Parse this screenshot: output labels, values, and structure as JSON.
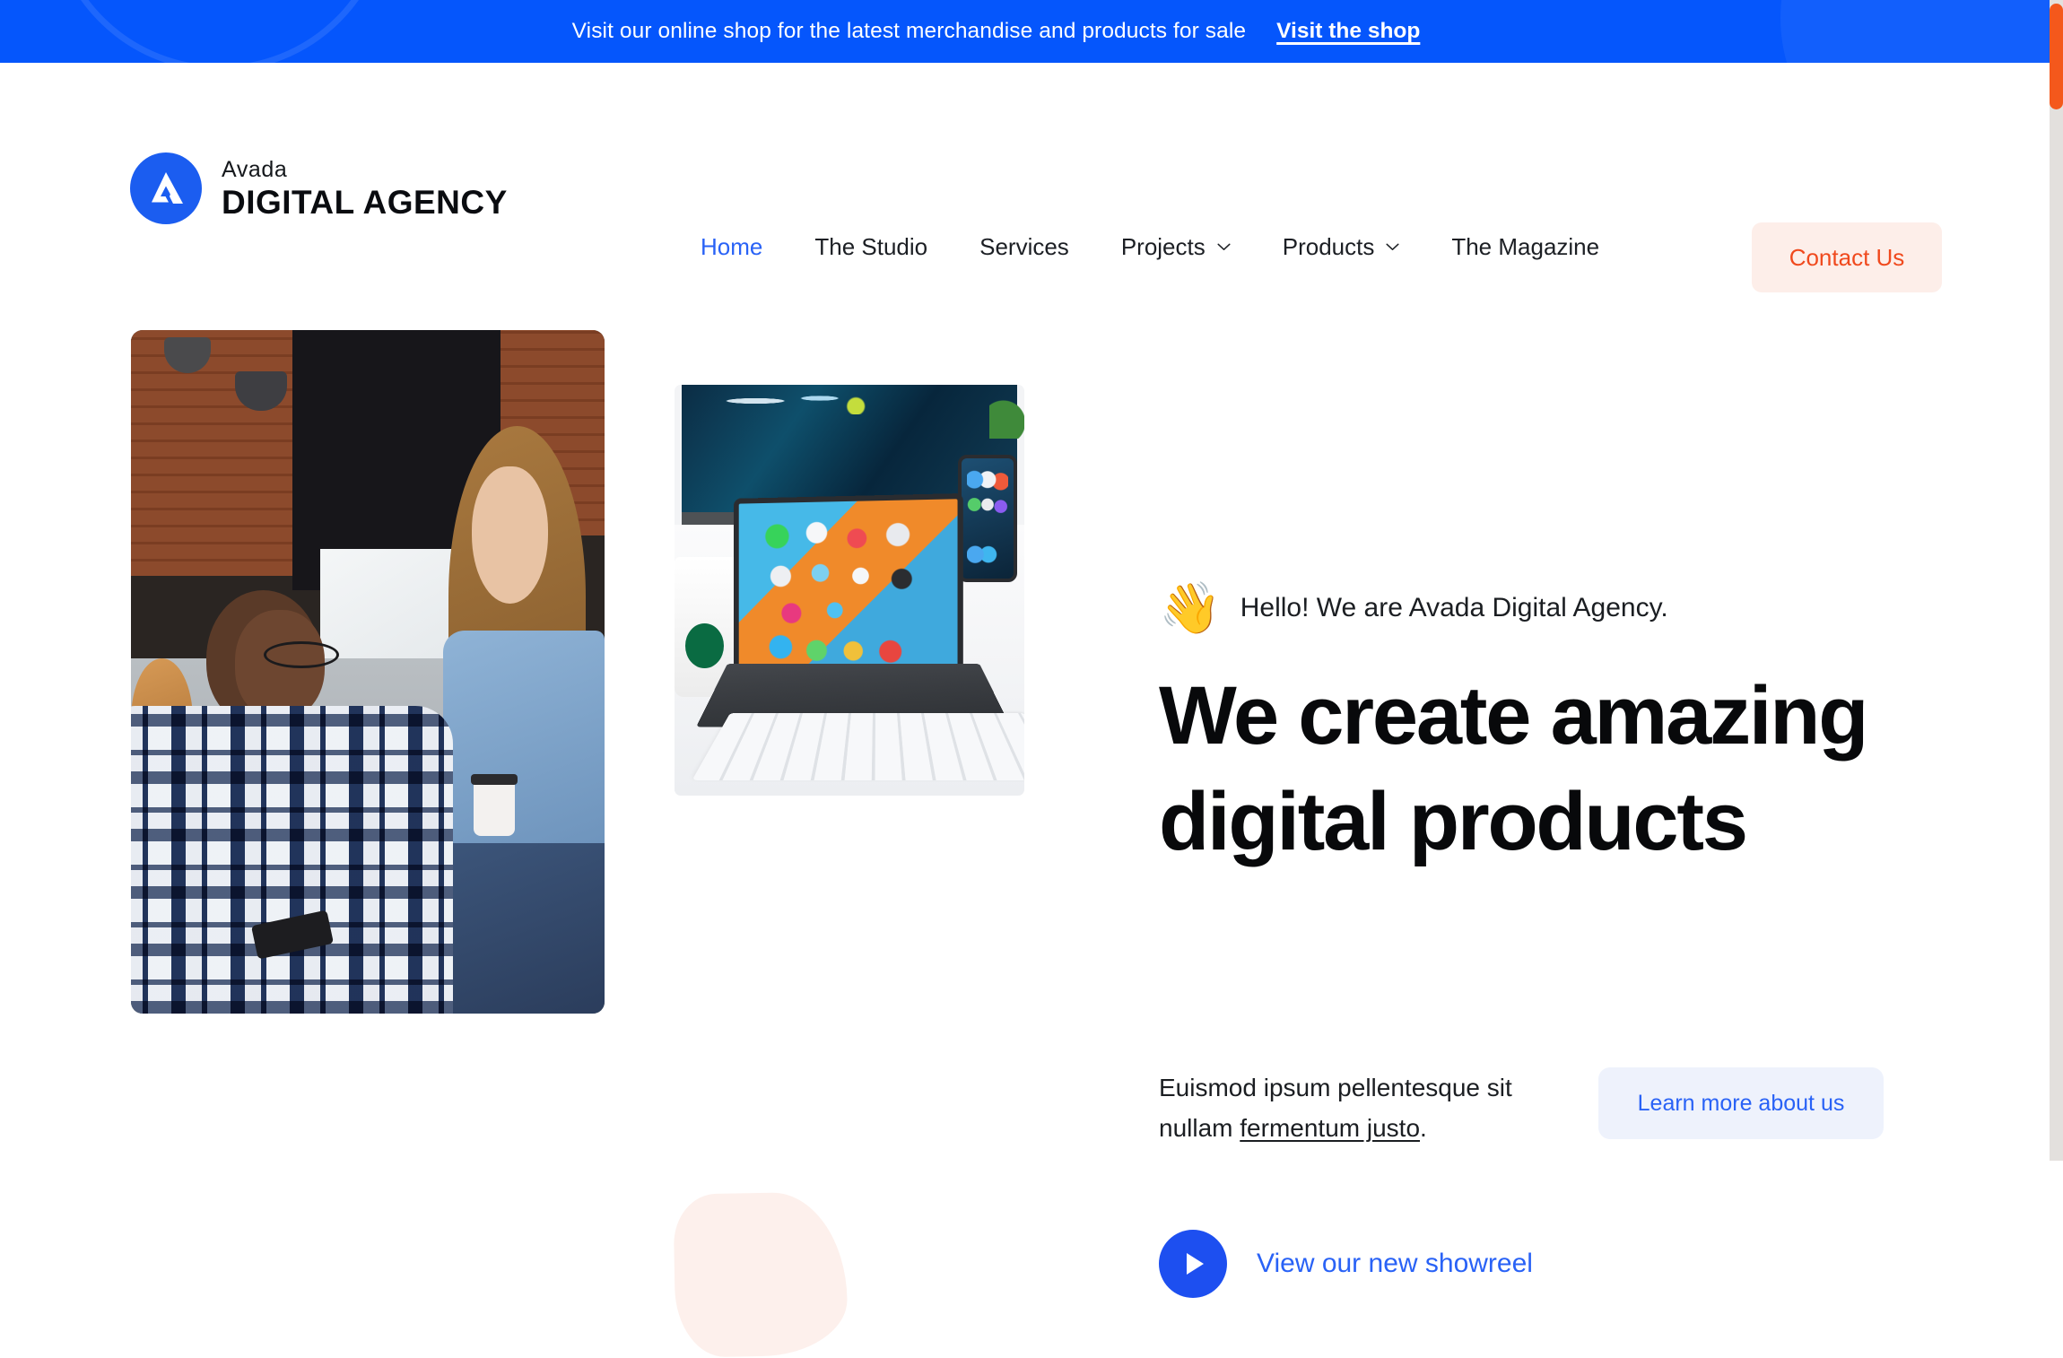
{
  "announcement": {
    "message": "Visit our online shop for the latest merchandise and products for sale",
    "link_label": "Visit the shop",
    "background_color": "#0556fc"
  },
  "brand": {
    "name_small": "Avada",
    "name_large": "DIGITAL AGENCY",
    "mark_icon": "mountain-peak-logo-icon",
    "mark_color": "#1b5df0"
  },
  "nav": {
    "items": [
      {
        "label": "Home",
        "active": true,
        "has_dropdown": false
      },
      {
        "label": "The Studio",
        "active": false,
        "has_dropdown": false
      },
      {
        "label": "Services",
        "active": false,
        "has_dropdown": false
      },
      {
        "label": "Projects",
        "active": false,
        "has_dropdown": true
      },
      {
        "label": "Products",
        "active": false,
        "has_dropdown": true
      },
      {
        "label": "The Magazine",
        "active": false,
        "has_dropdown": false
      }
    ],
    "active_color": "#2962f6",
    "contact_button": {
      "label": "Contact Us",
      "text_color": "#f0491d",
      "background_color": "#fdeee9"
    }
  },
  "hero": {
    "greeting_emoji": "👋",
    "greeting_emoji_name": "waving-hand-emoji",
    "greeting": "Hello! We are Avada Digital Agency.",
    "headline": "We create amazing digital products",
    "lead_before": "Euismod ipsum pellentesque sit nullam ",
    "lead_link": "fermentum justo",
    "lead_after": ".",
    "learn_more_label": "Learn more about us",
    "learn_more_text_color": "#2962f6",
    "learn_more_background": "#eef2fc",
    "showreel_label": "View our new showreel",
    "showreel_play_color": "#1d4ff0",
    "image_people_alt": "Two colleagues talking in an office, man holding phone and woman holding coffee cup",
    "image_devices_alt": "Desk with monitor, iPad with keyboard, iPhone and Apple keyboard",
    "blob_color": "#fdf0ec"
  },
  "scrollbar": {
    "thumb_color": "#f4581c",
    "track_color": "#e3e0dd"
  }
}
